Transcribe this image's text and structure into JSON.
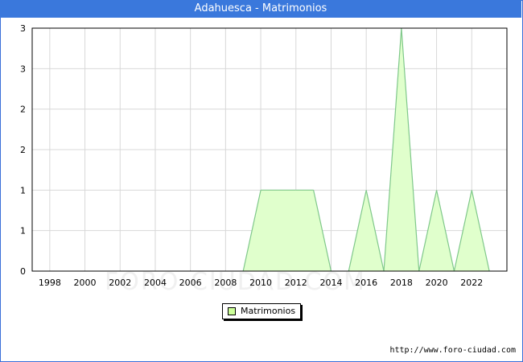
{
  "title": "Adahuesca - Matrimonios",
  "footer": "http://www.foro-ciudad.com",
  "watermark": "FORO-CIUDAD.COM",
  "colors": {
    "fill": "#e0ffcc",
    "line": "#7fc88a",
    "legend_swatch": "#ccff99",
    "grid": "#d8d8d8",
    "title_bg": "#3a78dc"
  },
  "chart_data": {
    "type": "area",
    "title": "Adahuesca - Matrimonios",
    "x": [
      1997,
      1998,
      1999,
      2000,
      2001,
      2002,
      2003,
      2004,
      2005,
      2006,
      2007,
      2008,
      2009,
      2010,
      2011,
      2012,
      2013,
      2014,
      2015,
      2016,
      2017,
      2018,
      2019,
      2020,
      2021,
      2022,
      2023
    ],
    "series": [
      {
        "name": "Matrimonios",
        "values": [
          0,
          0,
          0,
          0,
          0,
          0,
          0,
          0,
          0,
          0,
          0,
          0,
          0,
          1,
          1,
          1,
          1,
          0,
          0,
          1,
          0,
          3,
          0,
          1,
          0,
          1,
          0
        ]
      }
    ],
    "x_ticks": [
      "1998",
      "2000",
      "2002",
      "2004",
      "2006",
      "2008",
      "2010",
      "2012",
      "2014",
      "2016",
      "2018",
      "2020",
      "2022"
    ],
    "y_tick_labels": [
      "0",
      "1",
      "1",
      "2",
      "2",
      "3",
      "3"
    ],
    "ylim": [
      0,
      3
    ],
    "xlim": [
      1997,
      2024
    ],
    "grid": true,
    "legend_position": "bottom-center"
  }
}
